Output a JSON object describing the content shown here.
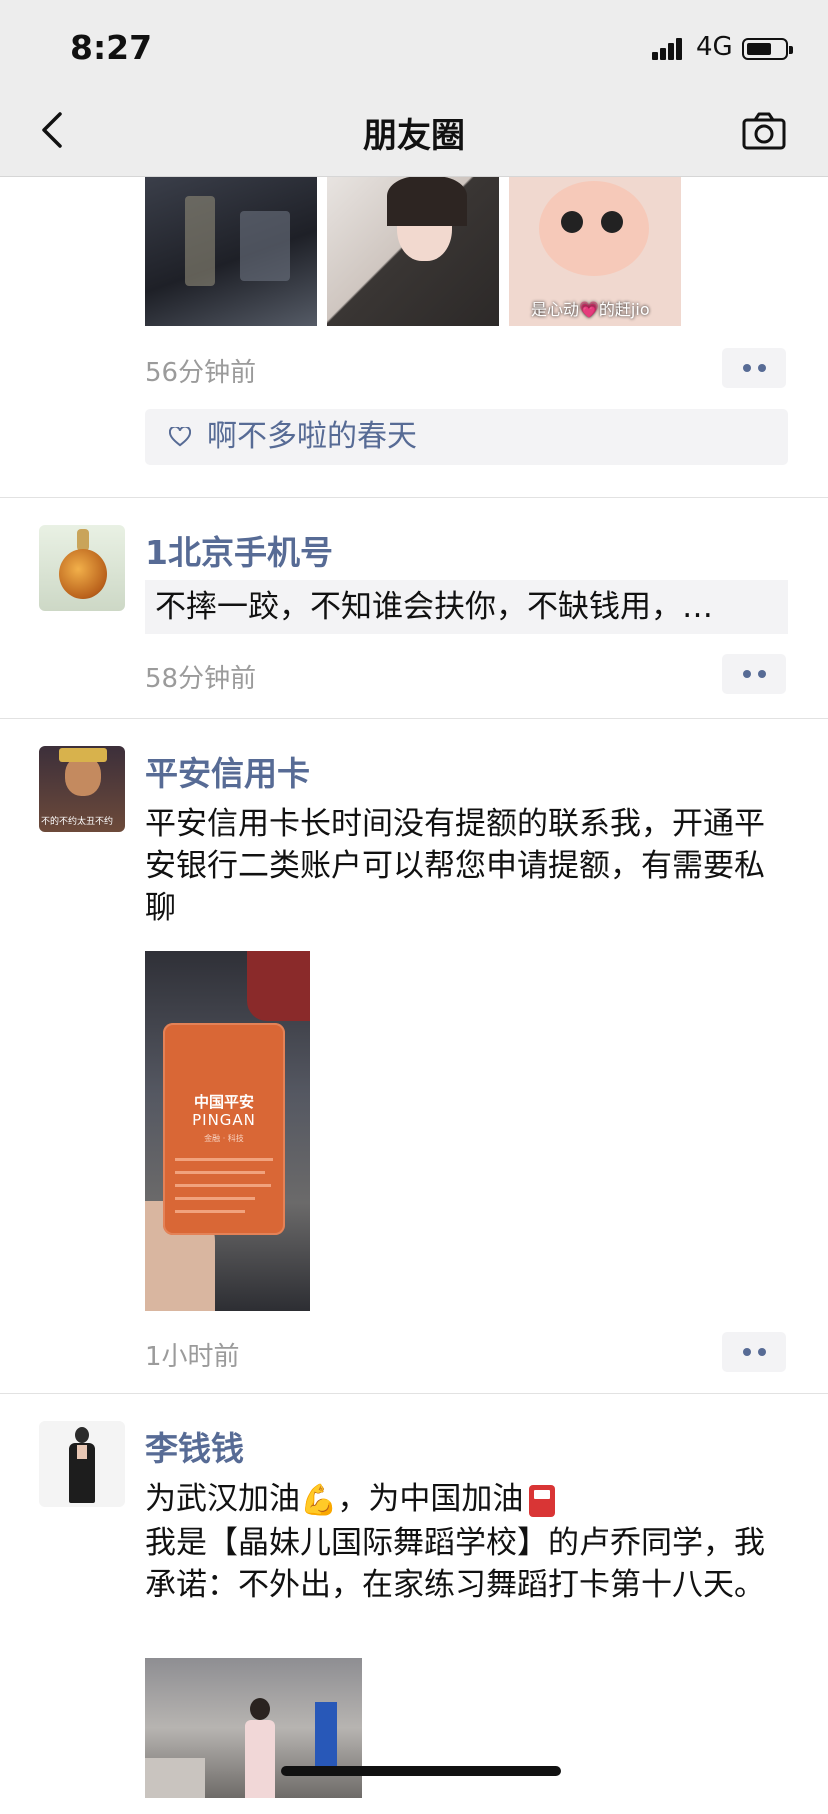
{
  "status": {
    "time": "8:27",
    "network": "4G"
  },
  "nav": {
    "title": "朋友圈",
    "back_icon": "chevron-left-icon",
    "camera_icon": "camera-icon"
  },
  "posts": [
    {
      "images_caption": "是心动💗的赶jio",
      "time": "56分钟前",
      "likes": [
        "啊不多啦的春天"
      ]
    },
    {
      "name": "1北京手机号",
      "share_text": "不摔一跤，不知谁会扶你，不缺钱用，…",
      "time": "58分钟前"
    },
    {
      "name": "平安信用卡",
      "text": "平安信用卡长时间没有提额的联系我，开通平安银行二类账户可以帮您申请提额，有需要私聊",
      "card_brand_cn": "中国平安",
      "card_brand_en": "PINGAN",
      "card_sub": "金融 · 科技",
      "avatar_caption": "不的不约太丑不约",
      "time": "1小时前"
    },
    {
      "name": "李钱钱",
      "text_line1_a": "为武汉加油",
      "text_line1_b": "，为中国加油",
      "text_rest": "我是【晶妹儿国际舞蹈学校】的卢乔同学，我承诺：不外出，在家练习舞蹈打卡第十八天。"
    }
  ]
}
